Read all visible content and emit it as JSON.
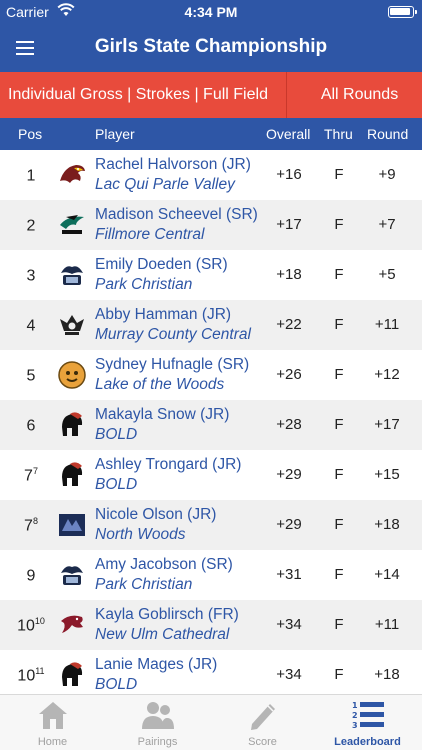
{
  "status": {
    "carrier": "Carrier",
    "time": "4:34 PM"
  },
  "header": {
    "title": "Girls State Championship"
  },
  "filters": {
    "view": "Individual Gross | Strokes | Full Field",
    "rounds": "All Rounds"
  },
  "columns": {
    "pos": "Pos",
    "player": "Player",
    "overall": "Overall",
    "thru": "Thru",
    "round": "Round"
  },
  "rows": [
    {
      "pos": "1",
      "pos_sup": "",
      "name": "Rachel Halvorson (JR)",
      "school": "Lac Qui Parle Valley",
      "overall": "+16",
      "thru": "F",
      "round": "+9",
      "logo": "eagle-logo"
    },
    {
      "pos": "2",
      "pos_sup": "",
      "name": "Madison Scheevel (SR)",
      "school": "Fillmore Central",
      "overall": "+17",
      "thru": "F",
      "round": "+7",
      "logo": "falcon-logo"
    },
    {
      "pos": "3",
      "pos_sup": "",
      "name": "Emily Doeden (SR)",
      "school": "Park Christian",
      "overall": "+18",
      "thru": "F",
      "round": "+5",
      "logo": "pc-falcon-logo"
    },
    {
      "pos": "4",
      "pos_sup": "",
      "name": "Abby Hamman (JR)",
      "school": "Murray County Central",
      "overall": "+22",
      "thru": "F",
      "round": "+11",
      "logo": "rebel-logo"
    },
    {
      "pos": "5",
      "pos_sup": "",
      "name": "Sydney Hufnagle (SR)",
      "school": "Lake of the Woods",
      "overall": "+26",
      "thru": "F",
      "round": "+12",
      "logo": "bear-logo"
    },
    {
      "pos": "6",
      "pos_sup": "",
      "name": "Makayla Snow (JR)",
      "school": "BOLD",
      "overall": "+28",
      "thru": "F",
      "round": "+17",
      "logo": "warrior-logo"
    },
    {
      "pos": "7",
      "pos_sup": "7",
      "name": "Ashley Trongard (JR)",
      "school": "BOLD",
      "overall": "+29",
      "thru": "F",
      "round": "+15",
      "logo": "warrior-logo"
    },
    {
      "pos": "7",
      "pos_sup": "8",
      "name": "Nicole Olson (JR)",
      "school": "North Woods",
      "overall": "+29",
      "thru": "F",
      "round": "+18",
      "logo": "nw-logo"
    },
    {
      "pos": "9",
      "pos_sup": "",
      "name": "Amy Jacobson (SR)",
      "school": "Park Christian",
      "overall": "+31",
      "thru": "F",
      "round": "+14",
      "logo": "pc-falcon-logo"
    },
    {
      "pos": "10",
      "pos_sup": "10",
      "name": "Kayla Goblirsch (FR)",
      "school": "New Ulm Cathedral",
      "overall": "+34",
      "thru": "F",
      "round": "+11",
      "logo": "greyhound-logo"
    },
    {
      "pos": "10",
      "pos_sup": "11",
      "name": "Lanie Mages (JR)",
      "school": "BOLD",
      "overall": "+34",
      "thru": "F",
      "round": "+18",
      "logo": "warrior-logo"
    }
  ],
  "tabs": [
    {
      "label": "Home",
      "icon": "home-icon",
      "active": false
    },
    {
      "label": "Pairings",
      "icon": "people-icon",
      "active": false
    },
    {
      "label": "Score",
      "icon": "pencil-icon",
      "active": false
    },
    {
      "label": "Leaderboard",
      "icon": "leaderboard-icon",
      "active": true
    }
  ],
  "colors": {
    "primary": "#2e56a6",
    "accent": "#e84b3c",
    "row_alt": "#f0f0f0"
  }
}
